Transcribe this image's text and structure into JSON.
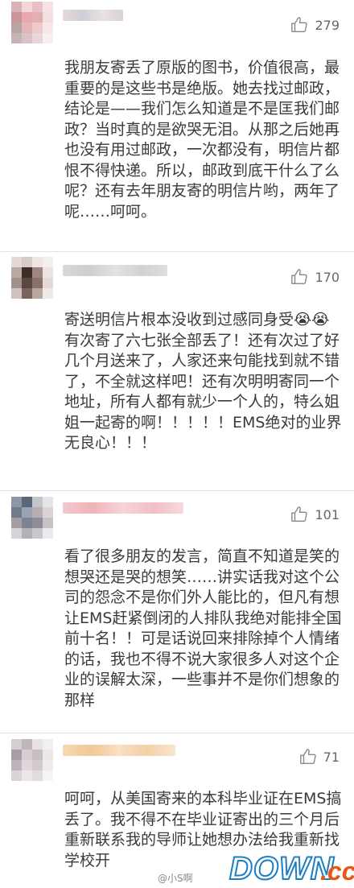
{
  "comments": [
    {
      "likes": "279",
      "text": "我朋友寄丢了原版的图书，价值很高，最重要的是这些书是绝版。她去找过邮政，结论是——我们怎么知道是不是匡我们邮政？当时真的是欲哭无泪。从那之后她再也没有用过邮政，一次都没有，明信片都恨不得快递。所以，邮政到底干什么了么呢？还有去年朋友寄的明信片哟，两年了呢……呵呵。"
    },
    {
      "likes": "170",
      "text": "寄送明信片根本没收到过感同身受😭😭有次寄了六七张全部丢了！还有次过了好几个月送来了，人家还来句能找到就不错了，不全就这样吧！还有次明明寄同一个地址，所有人都有就少一个人的，特么姐姐一起寄的啊！！！！！EMS绝对的业界无良心！！！"
    },
    {
      "likes": "101",
      "text": "看了很多朋友的发言，简直不知道是笑的想哭还是哭的想笑……讲实话我对这个公司的怨念不是你们外人能比的，但凡有想让EMS赶紧倒闭的人排队我绝对能排全国前十名！！可是话说回来排除掉个人情绪的话，我也不得不说大家很多人对这个企业的误解太深，一些事并不是你们想象的那样"
    },
    {
      "likes": "71",
      "text": "呵呵，从美国寄来的本科毕业证在EMS搞丢了。我不得不在毕业证寄出的三个月后重新联系我的导师让她想办法给我重新找学校开"
    }
  ],
  "watermark": {
    "brand": "DOWN",
    "tld": ".cc",
    "handle": "@小S啊"
  },
  "colors": {
    "text": "#3a3a3a",
    "likes": "#666666",
    "divider": "#e3e3e3",
    "watermark_blue": "#1c7fc2",
    "watermark_orange": "#e95513"
  },
  "icons": {
    "like": "thumbs-up-outline-icon",
    "avatar": "pixelated-avatar",
    "username": "blurred-username"
  }
}
